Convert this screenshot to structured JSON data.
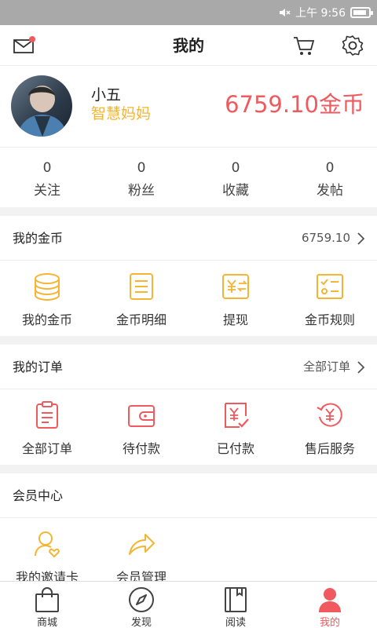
{
  "status_bar": {
    "time": "上午 9:56",
    "battery_level": 0.9,
    "icons": [
      "mute-icon",
      "battery-icon"
    ]
  },
  "header": {
    "title": "我的",
    "icons": [
      "mail-icon",
      "cart-icon",
      "gear-icon"
    ]
  },
  "profile": {
    "username": "小五",
    "user_title": "智慧妈妈",
    "coin_total": "6759.10金币"
  },
  "stats": [
    {
      "value": "0",
      "label": "关注"
    },
    {
      "value": "0",
      "label": "粉丝"
    },
    {
      "value": "0",
      "label": "收藏"
    },
    {
      "value": "0",
      "label": "发帖"
    }
  ],
  "coins_section": {
    "title": "我的金币",
    "right_text": "6759.10",
    "items": [
      {
        "label": "我的金币",
        "icon": "coin-stack-icon"
      },
      {
        "label": "金币明细",
        "icon": "receipt-icon"
      },
      {
        "label": "提现",
        "icon": "withdraw-icon"
      },
      {
        "label": "金币规则",
        "icon": "rules-icon"
      }
    ]
  },
  "orders_section": {
    "title": "我的订单",
    "right_text": "全部订单",
    "items": [
      {
        "label": "全部订单",
        "icon": "clipboard-icon"
      },
      {
        "label": "待付款",
        "icon": "wallet-icon"
      },
      {
        "label": "已付款",
        "icon": "paid-icon"
      },
      {
        "label": "售后服务",
        "icon": "refund-icon"
      }
    ]
  },
  "member_section": {
    "title": "会员中心",
    "items": [
      {
        "label": "我的邀请卡",
        "icon": "invite-card-icon"
      },
      {
        "label": "会员管理",
        "icon": "share-arrow-icon"
      }
    ]
  },
  "tabbar": {
    "active": "我的",
    "items": [
      {
        "label": "商城",
        "icon": "shopping-bag-icon"
      },
      {
        "label": "发现",
        "icon": "compass-icon"
      },
      {
        "label": "阅读",
        "icon": "book-icon"
      },
      {
        "label": "我的",
        "icon": "person-icon"
      }
    ]
  },
  "colors": {
    "accent": "#ee5a5e",
    "gold": "#f5b432",
    "status_bar": "#a9a9a9"
  }
}
